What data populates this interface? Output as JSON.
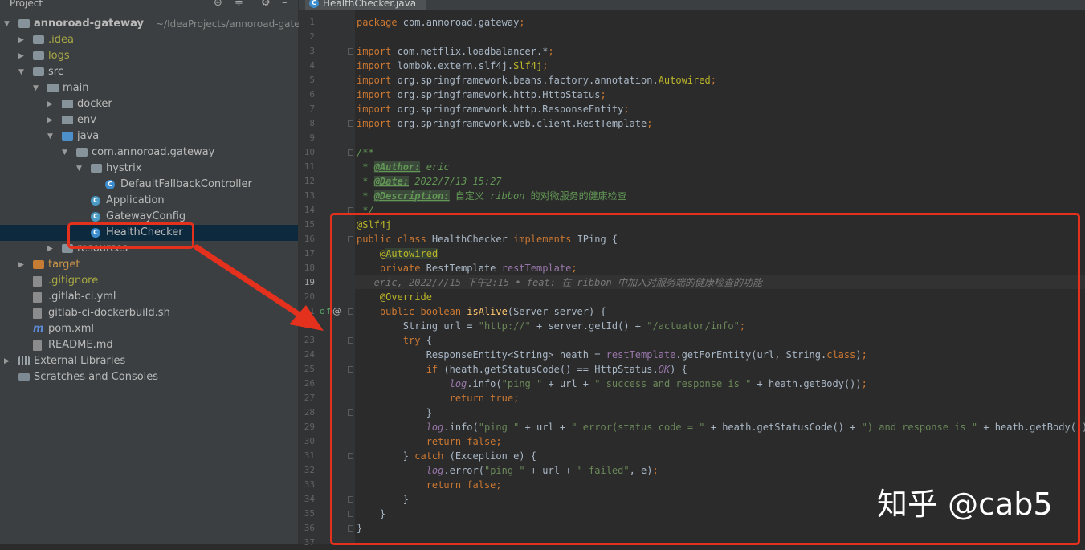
{
  "project_panel": {
    "title": "Project",
    "tree": [
      {
        "label": "annoroad-gateway",
        "path": "~/IdeaProjects/annoroad-gatev",
        "depth": 0,
        "arrow": "down",
        "icon": "module-folder-icon",
        "bold": true
      },
      {
        "label": ".idea",
        "depth": 1,
        "arrow": "right",
        "icon": "folder-icon",
        "color": "olive"
      },
      {
        "label": "logs",
        "depth": 1,
        "arrow": "right",
        "icon": "folder-icon",
        "color": "olive"
      },
      {
        "label": "src",
        "depth": 1,
        "arrow": "down",
        "icon": "folder-icon"
      },
      {
        "label": "main",
        "depth": 2,
        "arrow": "down",
        "icon": "folder-icon"
      },
      {
        "label": "docker",
        "depth": 3,
        "arrow": "right",
        "icon": "folder-icon"
      },
      {
        "label": "env",
        "depth": 3,
        "arrow": "right",
        "icon": "folder-icon"
      },
      {
        "label": "java",
        "depth": 3,
        "arrow": "down",
        "icon": "source-folder-icon"
      },
      {
        "label": "com.annoroad.gateway",
        "depth": 4,
        "arrow": "down",
        "icon": "package-icon"
      },
      {
        "label": "hystrix",
        "depth": 5,
        "arrow": "down",
        "icon": "package-icon"
      },
      {
        "label": "DefaultFallbackController",
        "depth": 6,
        "arrow": "",
        "icon": "class-icon"
      },
      {
        "label": "Application",
        "depth": 5,
        "arrow": "",
        "icon": "spring-class-icon"
      },
      {
        "label": "GatewayConfig",
        "depth": 5,
        "arrow": "",
        "icon": "spring-class-icon"
      },
      {
        "label": "HealthChecker",
        "depth": 5,
        "arrow": "",
        "icon": "class-icon",
        "selected": true
      },
      {
        "label": "resources",
        "depth": 3,
        "arrow": "right",
        "icon": "resources-folder-icon"
      },
      {
        "label": "target",
        "depth": 1,
        "arrow": "right",
        "icon": "excluded-folder-icon",
        "color": "orange"
      },
      {
        "label": ".gitignore",
        "depth": 1,
        "arrow": "",
        "icon": "gitignore-file-icon",
        "color": "olive"
      },
      {
        "label": ".gitlab-ci.yml",
        "depth": 1,
        "arrow": "",
        "icon": "yaml-file-icon"
      },
      {
        "label": "gitlab-ci-dockerbuild.sh",
        "depth": 1,
        "arrow": "",
        "icon": "shell-file-icon"
      },
      {
        "label": "pom.xml",
        "depth": 1,
        "arrow": "",
        "icon": "maven-icon"
      },
      {
        "label": "README.md",
        "depth": 1,
        "arrow": "",
        "icon": "markdown-file-icon"
      },
      {
        "label": "External Libraries",
        "depth": 0,
        "arrow": "right",
        "icon": "libraries-icon"
      },
      {
        "label": "Scratches and Consoles",
        "depth": 0,
        "arrow": "",
        "icon": "scratches-icon"
      }
    ]
  },
  "editor": {
    "tab": {
      "label": "HealthChecker.java",
      "icon": "java-class-icon"
    },
    "current_line": 19,
    "lines": [
      {
        "n": "1",
        "t": [
          [
            "kw",
            "package "
          ],
          [
            "",
            "com.annoroad.gateway"
          ],
          [
            "kw",
            ";"
          ]
        ]
      },
      {
        "n": "2",
        "t": []
      },
      {
        "n": "3",
        "t": [
          [
            "kw",
            "import "
          ],
          [
            "",
            "com.netflix.loadbalancer.*"
          ],
          [
            "kw",
            ";"
          ]
        ]
      },
      {
        "n": "4",
        "t": [
          [
            "kw",
            "import "
          ],
          [
            "",
            "lombok.extern.slf4j."
          ],
          [
            "an",
            "Slf4j"
          ],
          [
            "kw",
            ";"
          ]
        ]
      },
      {
        "n": "5",
        "t": [
          [
            "kw",
            "import "
          ],
          [
            "",
            "org.springframework.beans.factory.annotation."
          ],
          [
            "an",
            "Autowired"
          ],
          [
            "kw",
            ";"
          ]
        ]
      },
      {
        "n": "6",
        "t": [
          [
            "kw",
            "import "
          ],
          [
            "",
            "org.springframework.http.HttpStatus"
          ],
          [
            "kw",
            ";"
          ]
        ]
      },
      {
        "n": "7",
        "t": [
          [
            "kw",
            "import "
          ],
          [
            "",
            "org.springframework.http.ResponseEntity"
          ],
          [
            "kw",
            ";"
          ]
        ]
      },
      {
        "n": "8",
        "t": [
          [
            "kw",
            "import "
          ],
          [
            "",
            "org.springframework.web.client.RestTemplate"
          ],
          [
            "kw",
            ";"
          ]
        ]
      },
      {
        "n": "9",
        "t": []
      },
      {
        "n": "10",
        "t": [
          [
            "dc",
            "/**"
          ]
        ]
      },
      {
        "n": "11",
        "t": [
          [
            "dc",
            " * "
          ],
          [
            "dtag",
            "@Author:"
          ],
          [
            "dc",
            " eric"
          ]
        ]
      },
      {
        "n": "12",
        "t": [
          [
            "dc",
            " * "
          ],
          [
            "dtag",
            "@Date:"
          ],
          [
            "dc",
            " 2022/7/13 15:27"
          ]
        ]
      },
      {
        "n": "13",
        "t": [
          [
            "dc",
            " * "
          ],
          [
            "dtag",
            "@Description:"
          ],
          [
            "dtxt",
            " 自定义 "
          ],
          [
            "dc",
            "ribbon"
          ],
          [
            "dtxt",
            " 的对微服务的健康检查"
          ]
        ]
      },
      {
        "n": "14",
        "t": [
          [
            "dc",
            " */"
          ]
        ]
      },
      {
        "n": "15",
        "t": [
          [
            "an",
            "@Slf4j"
          ]
        ]
      },
      {
        "n": "16",
        "t": [
          [
            "kw",
            "public class "
          ],
          [
            "",
            "HealthChecker "
          ],
          [
            "kw",
            "implements "
          ],
          [
            "",
            "IPing {"
          ]
        ]
      },
      {
        "n": "17",
        "t": [
          [
            "",
            "    "
          ],
          [
            "an",
            "@"
          ],
          [
            "an-hl",
            "Autowired"
          ]
        ]
      },
      {
        "n": "18",
        "t": [
          [
            "",
            "    "
          ],
          [
            "kw",
            "private "
          ],
          [
            "",
            "RestTemplate "
          ],
          [
            "fld",
            "restTemplate"
          ],
          [
            "kw",
            ";"
          ]
        ]
      },
      {
        "n": "19",
        "t": [
          [
            "blame",
            "   eric, 2022/7/15 下午2:15 • feat: 在 ribbon 中加入对服务端的健康检查的功能"
          ]
        ],
        "blame": true
      },
      {
        "n": "20",
        "t": [
          [
            "",
            "    "
          ],
          [
            "an",
            "@Override"
          ]
        ]
      },
      {
        "n": "21",
        "t": [
          [
            "",
            "    "
          ],
          [
            "kw",
            "public boolean "
          ],
          [
            "fn",
            "isAlive"
          ],
          [
            "",
            "(Server server) {"
          ]
        ]
      },
      {
        "n": "22",
        "t": [
          [
            "",
            "        String url = "
          ],
          [
            "str",
            "\"http://\""
          ],
          [
            "",
            " + server.getId() + "
          ],
          [
            "str",
            "\"/actuator/info\""
          ],
          [
            "kw",
            ";"
          ]
        ]
      },
      {
        "n": "23",
        "t": [
          [
            "",
            "        "
          ],
          [
            "kw",
            "try "
          ],
          [
            "",
            "{"
          ]
        ]
      },
      {
        "n": "24",
        "t": [
          [
            "",
            "            ResponseEntity<String> heath = "
          ],
          [
            "fld",
            "restTemplate"
          ],
          [
            "",
            ".getForEntity(url, String."
          ],
          [
            "kw",
            "class"
          ],
          [
            "",
            ")"
          ],
          [
            "kw",
            ";"
          ]
        ]
      },
      {
        "n": "25",
        "t": [
          [
            "",
            "            "
          ],
          [
            "kw",
            "if "
          ],
          [
            "",
            "(heath.getStatusCode() == HttpStatus."
          ],
          [
            "itf",
            "OK"
          ],
          [
            "",
            ") {"
          ]
        ]
      },
      {
        "n": "26",
        "t": [
          [
            "",
            "                "
          ],
          [
            "lg",
            "log"
          ],
          [
            "",
            ".info("
          ],
          [
            "str",
            "\"ping \""
          ],
          [
            "",
            " + url + "
          ],
          [
            "str",
            "\" success and response is \""
          ],
          [
            "",
            " + heath.getBody())"
          ],
          [
            "kw",
            ";"
          ]
        ]
      },
      {
        "n": "27",
        "t": [
          [
            "",
            "                "
          ],
          [
            "kw",
            "return true;"
          ]
        ]
      },
      {
        "n": "28",
        "t": [
          [
            "",
            "            }"
          ]
        ]
      },
      {
        "n": "29",
        "t": [
          [
            "",
            "            "
          ],
          [
            "lg",
            "log"
          ],
          [
            "",
            ".info("
          ],
          [
            "str",
            "\"ping \""
          ],
          [
            "",
            " + url + "
          ],
          [
            "str",
            "\" error(status code = \""
          ],
          [
            "",
            " + heath.getStatusCode() + "
          ],
          [
            "str",
            "\") and response is \""
          ],
          [
            "",
            " + heath.getBody())"
          ],
          [
            "kw",
            ";"
          ]
        ]
      },
      {
        "n": "30",
        "t": [
          [
            "",
            "            "
          ],
          [
            "kw",
            "return false;"
          ]
        ]
      },
      {
        "n": "31",
        "t": [
          [
            "",
            "        } "
          ],
          [
            "kw",
            "catch "
          ],
          [
            "",
            "(Exception e) {"
          ]
        ]
      },
      {
        "n": "32",
        "t": [
          [
            "",
            "            "
          ],
          [
            "lg",
            "log"
          ],
          [
            "",
            ".error("
          ],
          [
            "str",
            "\"ping \""
          ],
          [
            "",
            " + url + "
          ],
          [
            "str",
            "\" failed\""
          ],
          [
            "",
            ", e)"
          ],
          [
            "kw",
            ";"
          ]
        ]
      },
      {
        "n": "33",
        "t": [
          [
            "",
            "            "
          ],
          [
            "kw",
            "return false;"
          ]
        ]
      },
      {
        "n": "34",
        "t": [
          [
            "",
            "        }"
          ]
        ]
      },
      {
        "n": "35",
        "t": [
          [
            "",
            "    }"
          ]
        ]
      },
      {
        "n": "36",
        "t": [
          [
            "",
            "}"
          ]
        ]
      },
      {
        "n": "37",
        "t": []
      }
    ]
  },
  "watermark": "知乎 @cab5",
  "colors": {
    "annotation_red": "#e3311e",
    "selection": "#0d293e"
  }
}
